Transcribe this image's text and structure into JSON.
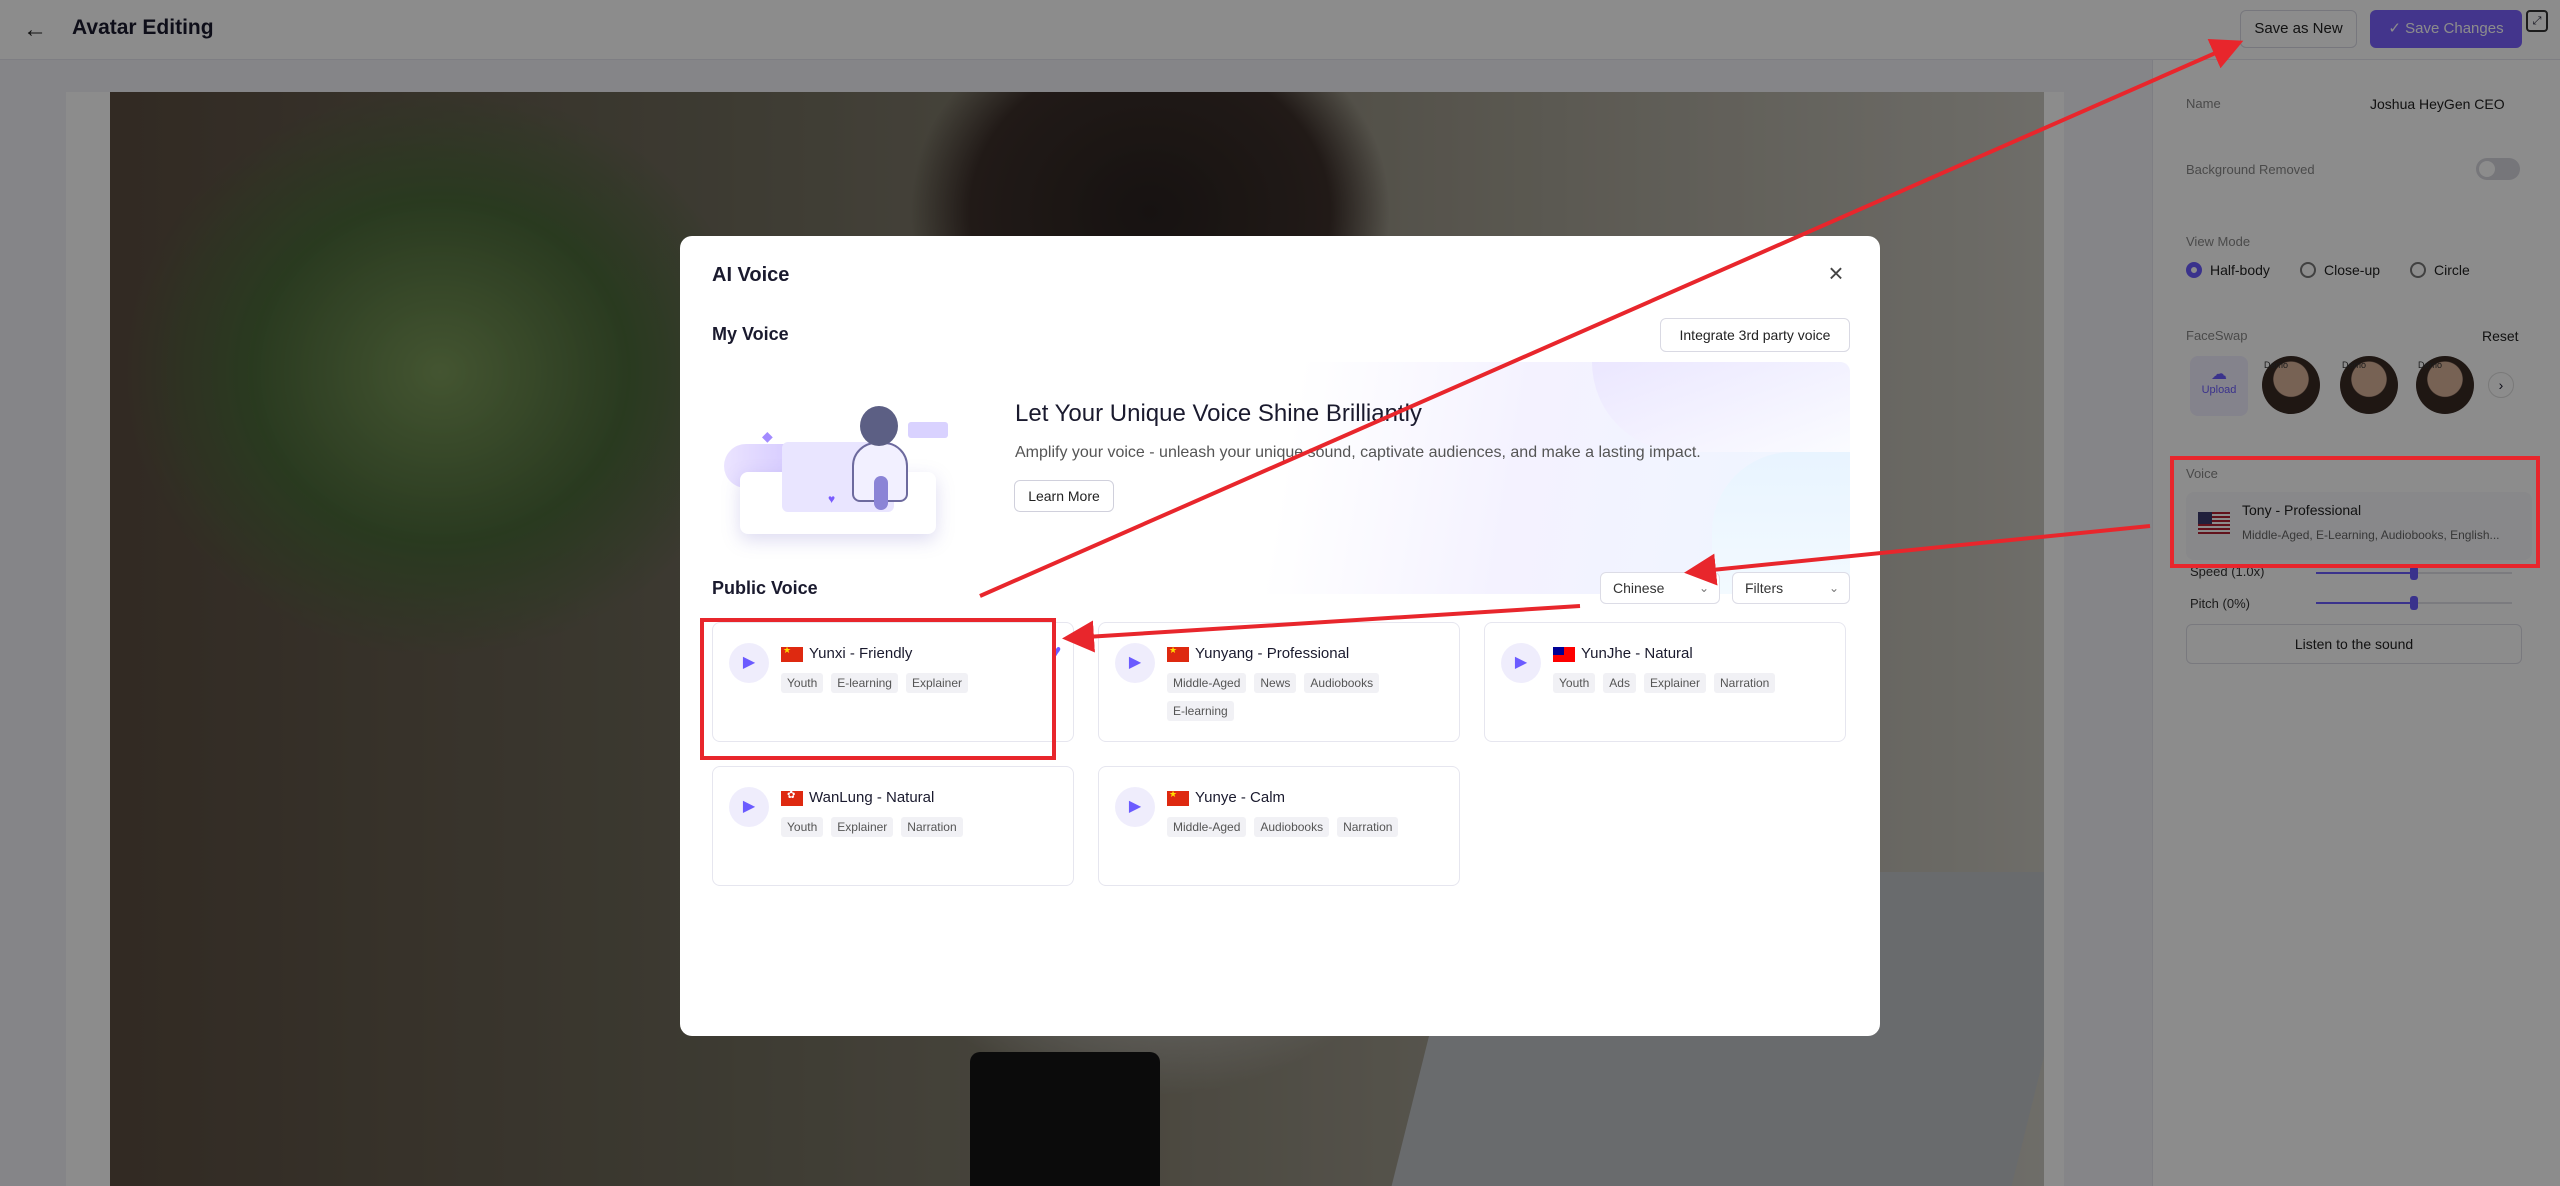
{
  "header": {
    "title": "Avatar Editing",
    "back_icon": "arrow-left-icon",
    "save_as_new": "Save as New",
    "save_changes": "Save Changes",
    "check_glyph": "✓",
    "fullscreen_icon": "fullscreen-icon"
  },
  "settings": {
    "name_label": "Name",
    "name_value": "Joshua HeyGen CEO",
    "bg_removed_label": "Background Removed",
    "bg_removed_on": false,
    "view_mode_label": "View Mode",
    "view_modes": [
      "Half-body",
      "Close-up",
      "Circle"
    ],
    "view_mode_selected": "Half-body",
    "faceswap_label": "FaceSwap",
    "faceswap_reset": "Reset",
    "upload_label": "Upload",
    "demo_badge": "Demo",
    "voice_label": "Voice",
    "current_voice_name": "Tony - Professional",
    "current_voice_tags": "Middle-Aged, E-Learning, Audiobooks, English...",
    "speed_label": "Speed (1.0x)",
    "pitch_label": "Pitch (0%)",
    "speed_value": 0.5,
    "pitch_value": 0.5,
    "listen_label": "Listen to the sound"
  },
  "modal": {
    "title": "AI Voice",
    "close_icon": "close-icon",
    "my_voice_title": "My Voice",
    "integrate_label": "Integrate 3rd party voice",
    "banner": {
      "title": "Let Your Unique Voice Shine Brilliantly",
      "subtitle": "Amplify your voice - unleash your unique sound, captivate audiences, and make a lasting impact.",
      "learn_more": "Learn More"
    },
    "public_voice_title": "Public Voice",
    "language_select": "Chinese",
    "filters_select": "Filters",
    "voices": [
      {
        "name": "Yunxi - Friendly",
        "flag": "cn",
        "tags": [
          "Youth",
          "E-learning",
          "Explainer"
        ],
        "favorite": true
      },
      {
        "name": "Yunyang - Professional",
        "flag": "cn",
        "tags": [
          "Middle-Aged",
          "News",
          "Audiobooks",
          "E-learning"
        ],
        "favorite": false
      },
      {
        "name": "YunJhe - Natural",
        "flag": "tw",
        "tags": [
          "Youth",
          "Ads",
          "Explainer",
          "Narration"
        ],
        "favorite": false
      },
      {
        "name": "WanLung - Natural",
        "flag": "hk",
        "tags": [
          "Youth",
          "Explainer",
          "Narration"
        ],
        "favorite": false
      },
      {
        "name": "Yunye - Calm",
        "flag": "cn",
        "tags": [
          "Middle-Aged",
          "Audiobooks",
          "Narration"
        ],
        "favorite": false
      }
    ]
  },
  "annotation_color": "#e8262c",
  "accent_color": "#6b5bff"
}
